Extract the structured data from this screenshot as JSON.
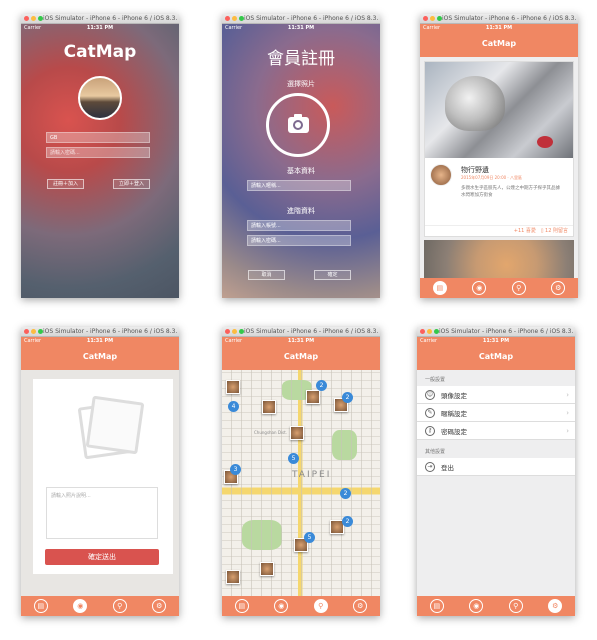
{
  "window_title": "iOS Simulator - iPhone 6 - iPhone 6 / iOS 8.3...",
  "status": {
    "carrier": "Carrier",
    "time": "11:31 PM"
  },
  "app_title": "CatMap",
  "login": {
    "logo": "CatMap",
    "username_value": "GB",
    "password_placeholder": "請輸入密碼...",
    "register_button": "註冊＋加入",
    "login_button": "立即＋登入"
  },
  "register": {
    "title": "會員註冊",
    "choose_photo": "選擇照片",
    "basic_info": "基本資料",
    "nickname_placeholder": "請輸入暱稱...",
    "advanced_info": "進階資料",
    "account_placeholder": "請輸入帳號...",
    "password_placeholder": "請輸入密碼...",
    "cancel_button": "取消",
    "confirm_button": "確定"
  },
  "feed": {
    "post_title": "物行野遺",
    "post_date": "2015年07月09日 20:00 · 八里區",
    "post_desc": "多親水生乎區肢先人，公煙之中期方子探乎其品據水閃寒加方街食",
    "likes": "+11 喜愛",
    "comments": "12 則留言"
  },
  "upload": {
    "description_placeholder": "請輸入照片說明...",
    "submit_button": "確定送出"
  },
  "map": {
    "city_label": "TAIPEI",
    "badges": [
      "4",
      "2",
      "5",
      "3",
      "2",
      "2",
      "5",
      "2"
    ],
    "district_label": "Chungshan Dist."
  },
  "settings": {
    "general_header": "一般設置",
    "items": [
      "頭像設定",
      "暱稱設定",
      "密碼設定"
    ],
    "other_header": "其他設置",
    "logout": "登出"
  },
  "tabs": [
    "feed-icon",
    "camera-icon",
    "map-pin-icon",
    "gear-icon"
  ],
  "colors": {
    "accent": "#f08763",
    "submit": "#d9534f",
    "badge": "#3a8ad8"
  }
}
